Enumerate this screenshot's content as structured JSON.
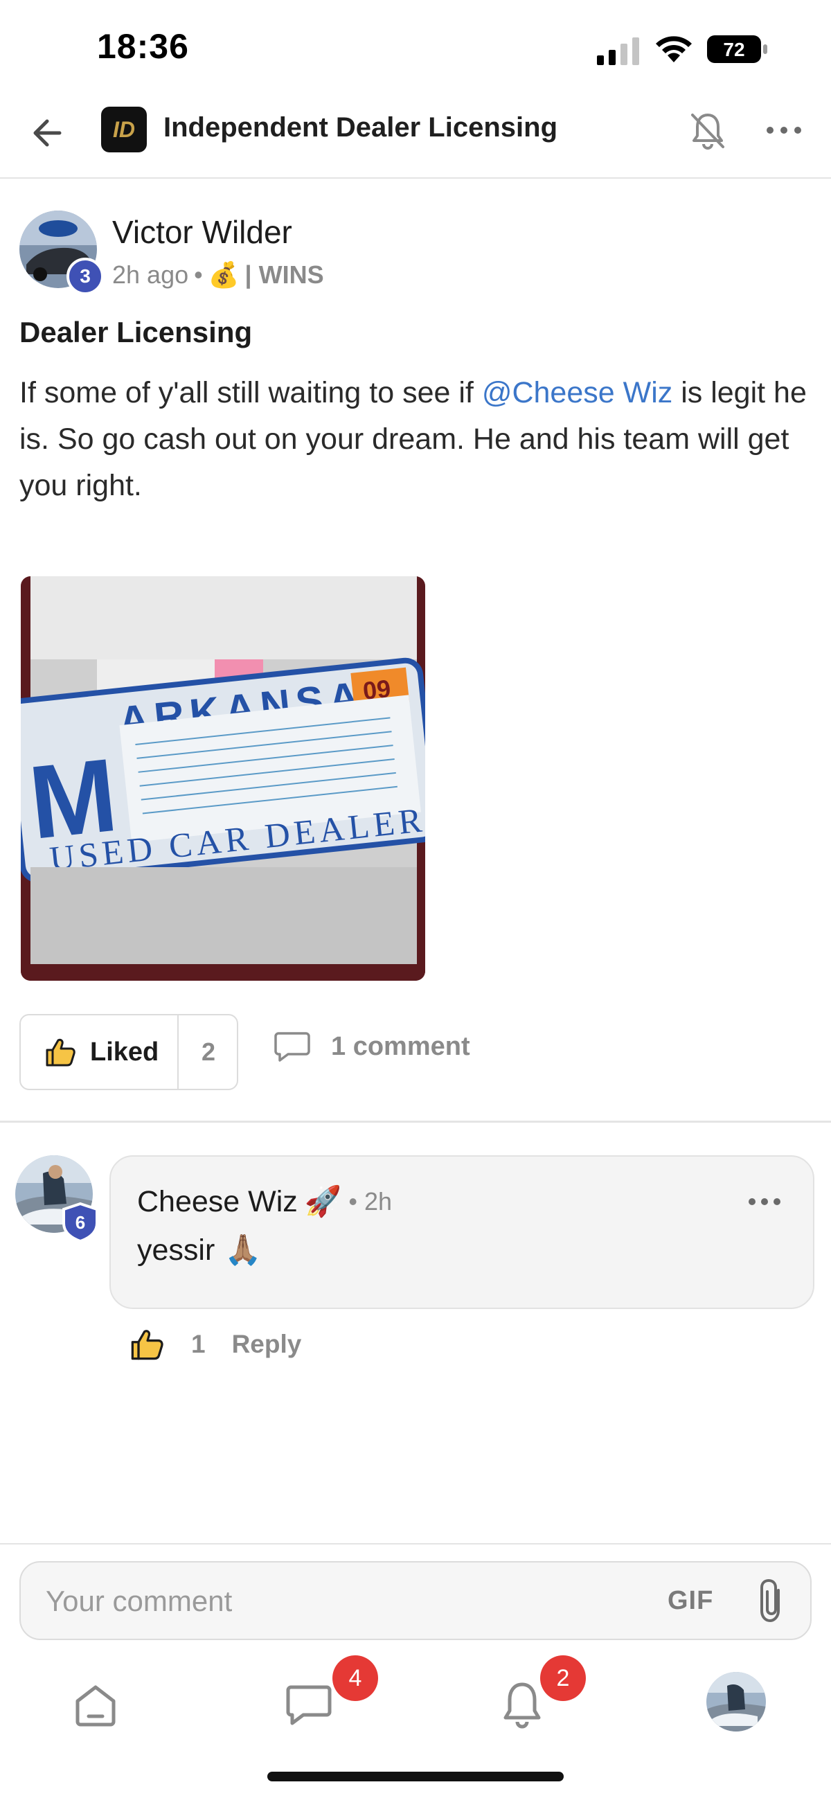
{
  "status_bar": {
    "time": "18:36",
    "battery": "72"
  },
  "header": {
    "title": "Independent Dealer Licensing",
    "logo_text": "ID"
  },
  "post": {
    "author": "Victor Wilder",
    "level": "3",
    "time": "2h ago",
    "separator": "•",
    "category_emoji": "💰",
    "category": "| WINS",
    "title": "Dealer Licensing",
    "body_before": "If some of y'all still waiting to see if ",
    "mention": "@Cheese Wiz",
    "body_after": " is legit he is. So go cash out on your dream. He and his team will get you right.",
    "image": {
      "plate_state": "ARKANSAS",
      "plate_letter": "M",
      "plate_bottom": "USED CAR DEALER",
      "plate_sticker": "09"
    },
    "like_label": "Liked",
    "like_count": "2",
    "comment_label": "1 comment"
  },
  "comment": {
    "author": "Cheese Wiz",
    "author_emoji": "🚀",
    "level": "6",
    "time": "• 2h",
    "text": "yessir",
    "text_emoji": "🙏🏽",
    "like_count": "1",
    "reply_label": "Reply"
  },
  "composer": {
    "placeholder": "Your comment",
    "gif_label": "GIF"
  },
  "bottom_nav": {
    "chat_badge": "4",
    "notifications_badge": "2"
  }
}
